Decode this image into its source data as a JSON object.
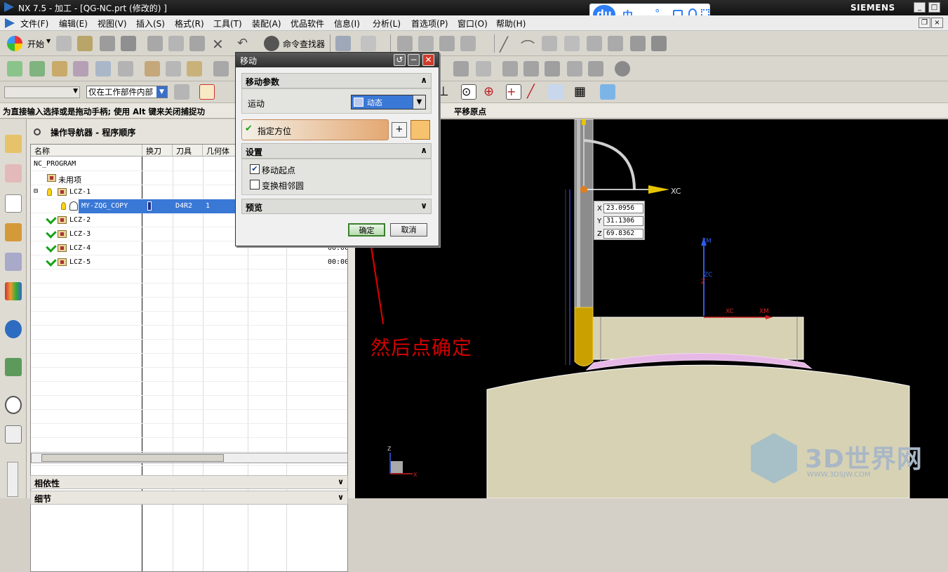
{
  "window": {
    "title": "NX 7.5 - 加工 - [QG-NC.prt (修改的) ]",
    "brand": "SIEMENS"
  },
  "menu": [
    "文件(F)",
    "编辑(E)",
    "视图(V)",
    "插入(S)",
    "格式(R)",
    "工具(T)",
    "装配(A)",
    "优品软件",
    "信息(I)",
    "分析(L)",
    "首选项(P)",
    "窗口(O)",
    "帮助(H)"
  ],
  "toolbar": {
    "start_label": "开始",
    "command_finder": "命令查找器",
    "selection_scope": "仅在工作部件内部"
  },
  "cue_line": "为直接输入选择或是拖动手柄; 使用 Alt 键来关闭捕捉功",
  "status_line": "平移原点",
  "navigator": {
    "title": "操作导航器 - 程序顺序",
    "columns": [
      "名称",
      "换刀",
      "刀具",
      "几何体"
    ],
    "rows": [
      {
        "name": "NC_PROGRAM",
        "tool_change": "",
        "tool": "",
        "geometry": "",
        "time": ""
      },
      {
        "name": "未用项",
        "tool_change": "",
        "tool": "",
        "geometry": "",
        "time": ""
      },
      {
        "name": "LCZ-1",
        "tool_change": "",
        "tool": "",
        "geometry": "",
        "time": ""
      },
      {
        "name": "MY-ZQG_COPY",
        "tool_change": "",
        "tool": "D4R2",
        "geometry": "1",
        "time": ""
      },
      {
        "name": "LCZ-2",
        "tool_change": "",
        "tool": "",
        "geometry": "",
        "time": ""
      },
      {
        "name": "LCZ-3",
        "tool_change": "",
        "tool": "",
        "geometry": "",
        "time": ""
      },
      {
        "name": "LCZ-4",
        "tool_change": "",
        "tool": "",
        "geometry": "",
        "time": "00:00"
      },
      {
        "name": "LCZ-5",
        "tool_change": "",
        "tool": "",
        "geometry": "",
        "time": "00:00"
      }
    ],
    "dependency_label": "相依性",
    "details_label": "细节"
  },
  "dialog": {
    "title": "移动",
    "section_params": "移动参数",
    "motion_label": "运动",
    "motion_value": "动态",
    "specify_orient": "指定方位",
    "section_settings": "设置",
    "move_origin": "移动起点",
    "transform_neighbors": "变换相邻圆",
    "move_origin_checked": true,
    "transform_neighbors_checked": false,
    "section_preview": "预览",
    "ok": "确定",
    "cancel": "取消"
  },
  "coords": {
    "x_label": "X",
    "y_label": "Y",
    "z_label": "Z",
    "x": "23.0956",
    "y": "31.1306",
    "z": "69.8362"
  },
  "axes": {
    "xc": "XC",
    "zm": "ZM",
    "zc": "ZC",
    "z": "Z",
    "xm": "XM",
    "x": "X"
  },
  "annotation": "然后点确定",
  "ime": {
    "logo": "du",
    "lang": "中",
    "dot": "°,"
  },
  "watermark": {
    "brand": "3D世界网",
    "url": "WWW.3DSJW.COM"
  }
}
